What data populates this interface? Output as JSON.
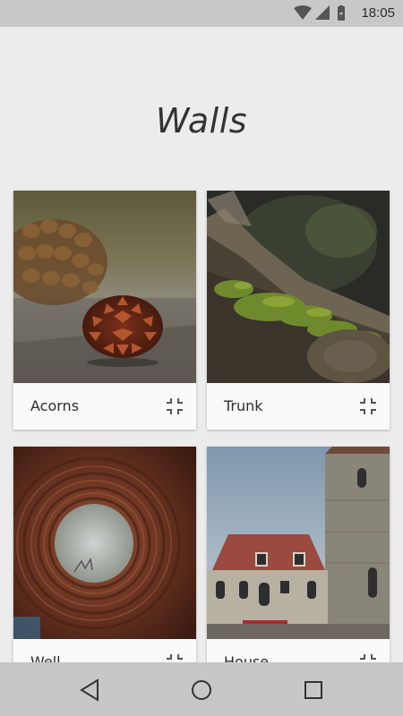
{
  "status_bar": {
    "time": "18:05",
    "icons": [
      "wifi-icon",
      "cell-signal-icon",
      "battery-icon"
    ]
  },
  "header": {
    "title": "Walls"
  },
  "walls": [
    {
      "label": "Acorns",
      "photo": "pine-cone-photo",
      "action_icon": "collapse-icon"
    },
    {
      "label": "Trunk",
      "photo": "mossy-trunk-photo",
      "action_icon": "collapse-icon"
    },
    {
      "label": "Well",
      "photo": "well-interior-photo",
      "action_icon": "collapse-icon"
    },
    {
      "label": "House",
      "photo": "stone-church-photo",
      "action_icon": "collapse-icon"
    }
  ],
  "nav_bar": {
    "icons": [
      "back-icon",
      "home-icon",
      "recents-icon"
    ]
  },
  "colors": {
    "background": "#ececec",
    "status_bar": "#c8c8c8",
    "nav_bar": "#c7c7c7",
    "card": "#fafafa",
    "text": "#333333"
  }
}
